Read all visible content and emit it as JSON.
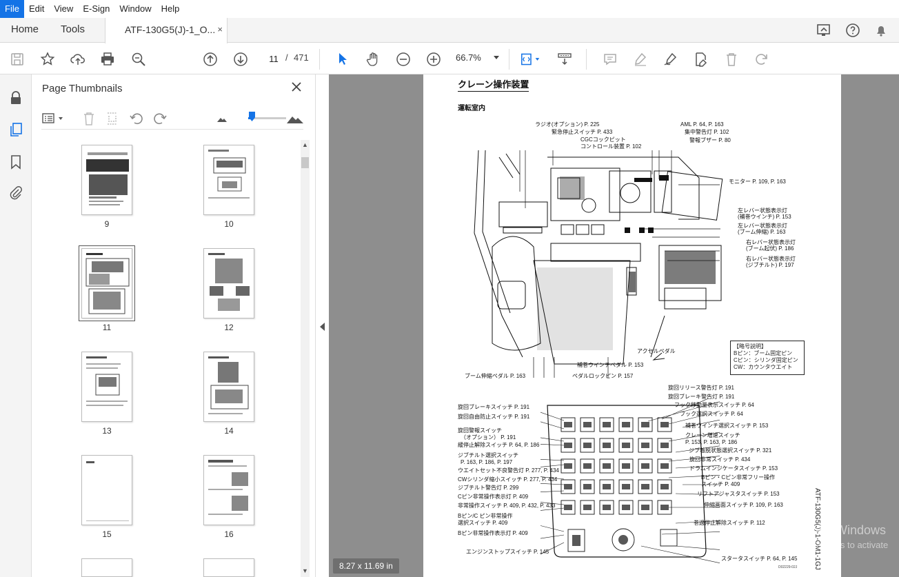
{
  "menu": {
    "items": [
      "File",
      "Edit",
      "View",
      "E-Sign",
      "Window",
      "Help"
    ]
  },
  "tabs": {
    "home": "Home",
    "tools": "Tools",
    "document": "ATF-130G5(J)-1_O...",
    "close": "×"
  },
  "toolbar": {
    "current_page": "11",
    "page_separator": "/",
    "total_pages": "471",
    "zoom": "66.7%"
  },
  "thumbnails_panel": {
    "title": "Page Thumbnails",
    "selected_page": 11,
    "pages": [
      "9",
      "10",
      "11",
      "12",
      "13",
      "14",
      "15",
      "16"
    ]
  },
  "document": {
    "title": "クレーン操作装置",
    "subtitle": "運転室内",
    "top_callouts": [
      "ラジオ(オプション) P. 225",
      "緊急停止スイッチ P. 433",
      "CGCコックピット",
      "コントロール装置 P. 102",
      "AML P. 64, P. 163",
      "集中警告灯 P. 102",
      "警報ブザー P. 80",
      "モニター P. 109, P. 163",
      "左レバー状態表示灯",
      "(補巻ウインチ) P. 153",
      "左レバー状態表示灯",
      "(ブーム伸縮) P. 163",
      "右レバー状態表示灯",
      "(ブーム起伏) P. 186",
      "右レバー状態表示灯",
      "(ジブチルト) P. 197",
      "アクセルペダル",
      "補巻ウインチペダル P. 153",
      "ブーム伸縮ペダル P. 163",
      "ペダルロックピン P. 157"
    ],
    "legend": [
      "【略号説明】",
      "Bピン：ブーム固定ピン",
      "Cピン：シリンダ固定ピン",
      "CW：カウンタウエイト"
    ],
    "left_callouts": [
      "旋回ブレーキスイッチ P. 191",
      "旋回自由防止スイッチ P. 191",
      "旋回警報スイッチ",
      "（オプション） P. 191",
      "緩停止解除スイッチ P. 64,  P. 186",
      "ジブチルト選択スイッチ",
      "P. 163, P. 186, P. 197",
      "ウエイトセット不良警告灯 P. 277,  P. 434",
      "CWシリンダ縮小スイッチ P. 277,  P. 434",
      "ジブチルト警告灯 P. 299",
      "Cピン非常操作表示灯 P. 409",
      "非常操作スイッチ P. 409, P. 432,  P. 433",
      "Bピン/C ピン非常操作",
      "選択スイッチ P. 409",
      "Bピン非常操作表示灯 P. 409",
      "エンジンストップスイッチ P. 145"
    ],
    "right_callouts": [
      "旋回リリース警告灯 P. 191",
      "旋回ブレーキ警告灯 P. 191",
      "フック移動量表示スイッチ P. 64",
      "フック選択スイッチ P. 64",
      "補巻ウインチ選択スイッチ P. 153",
      "クレーン増速スイッチ",
      "P. 153, P. 163,  P. 186",
      "ジブ着脱状態選択スイッチ P. 321",
      "旋回非常スイッチ P. 434",
      "ドラムインジケータスイッチ P. 153",
      "Bピン・Cピン非常フリー操作",
      "スイッチ P. 409",
      "リフトアジャスタスイッチ P. 153",
      "伸縮画面スイッチ P. 109, P. 163",
      "巻過停止解除スイッチ P. 112",
      "スタータスイッチ P. 64, P. 145"
    ],
    "side_code": "ATF-130G5(J)-1-OM1-1GJ",
    "doc_number": "D02229-02J",
    "page_size": "8.27 x 11.69 in"
  },
  "watermark": {
    "line1": "Activate Windows",
    "line2": "Go to Settings to activate"
  }
}
